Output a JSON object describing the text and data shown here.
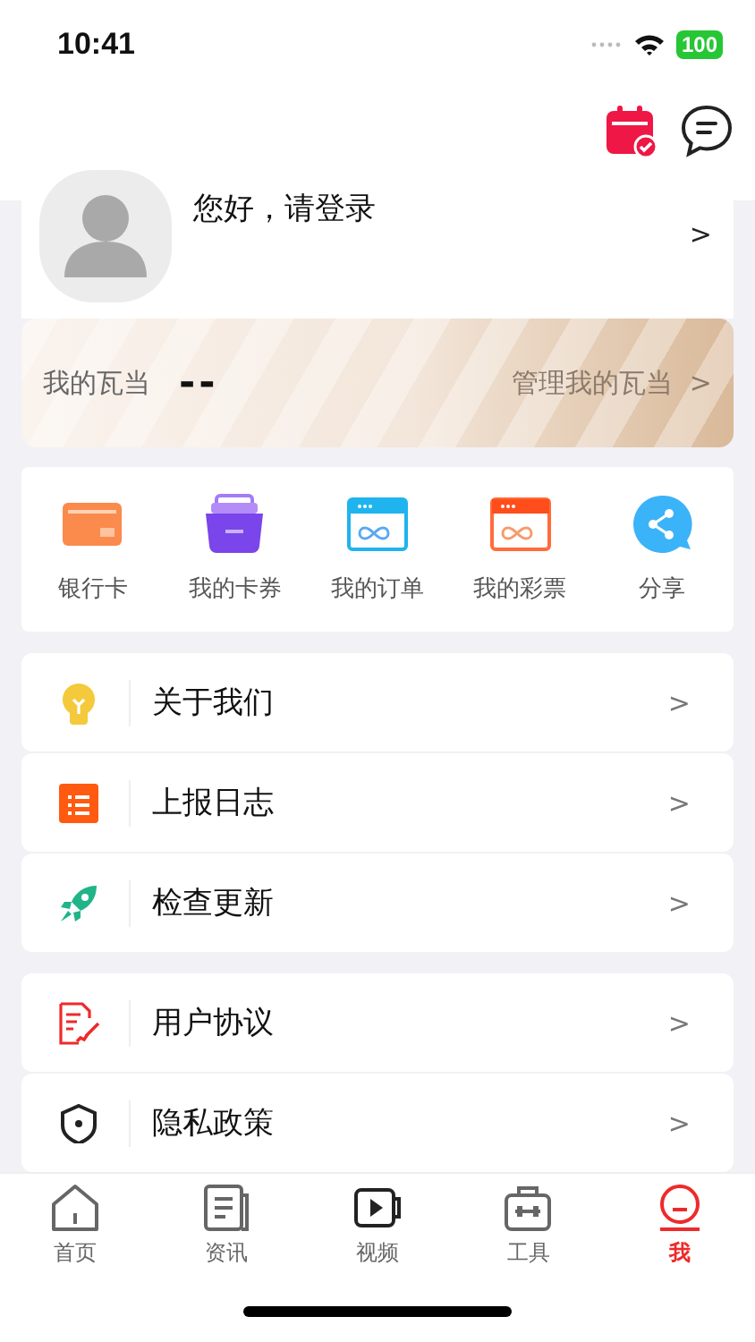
{
  "status_bar": {
    "time": "10:41",
    "battery": "100"
  },
  "profile": {
    "greeting": "您好，请登录",
    "chevron": ">"
  },
  "wallet": {
    "label": "我的瓦当",
    "value": "--",
    "link": "管理我的瓦当",
    "chevron": ">"
  },
  "shortcuts": [
    {
      "label": "银行卡"
    },
    {
      "label": "我的卡券"
    },
    {
      "label": "我的订单"
    },
    {
      "label": "我的彩票"
    },
    {
      "label": "分享"
    }
  ],
  "menu_groups": [
    [
      {
        "label": "关于我们",
        "chevron": ">"
      },
      {
        "label": "上报日志",
        "chevron": ">"
      },
      {
        "label": "检查更新",
        "chevron": ">"
      }
    ],
    [
      {
        "label": "用户协议",
        "chevron": ">"
      },
      {
        "label": "隐私政策",
        "chevron": ">"
      }
    ]
  ],
  "tab_bar": [
    {
      "label": "首页",
      "selected": false
    },
    {
      "label": "资讯",
      "selected": false
    },
    {
      "label": "视频",
      "selected": false
    },
    {
      "label": "工具",
      "selected": false
    },
    {
      "label": "我",
      "selected": true
    }
  ]
}
